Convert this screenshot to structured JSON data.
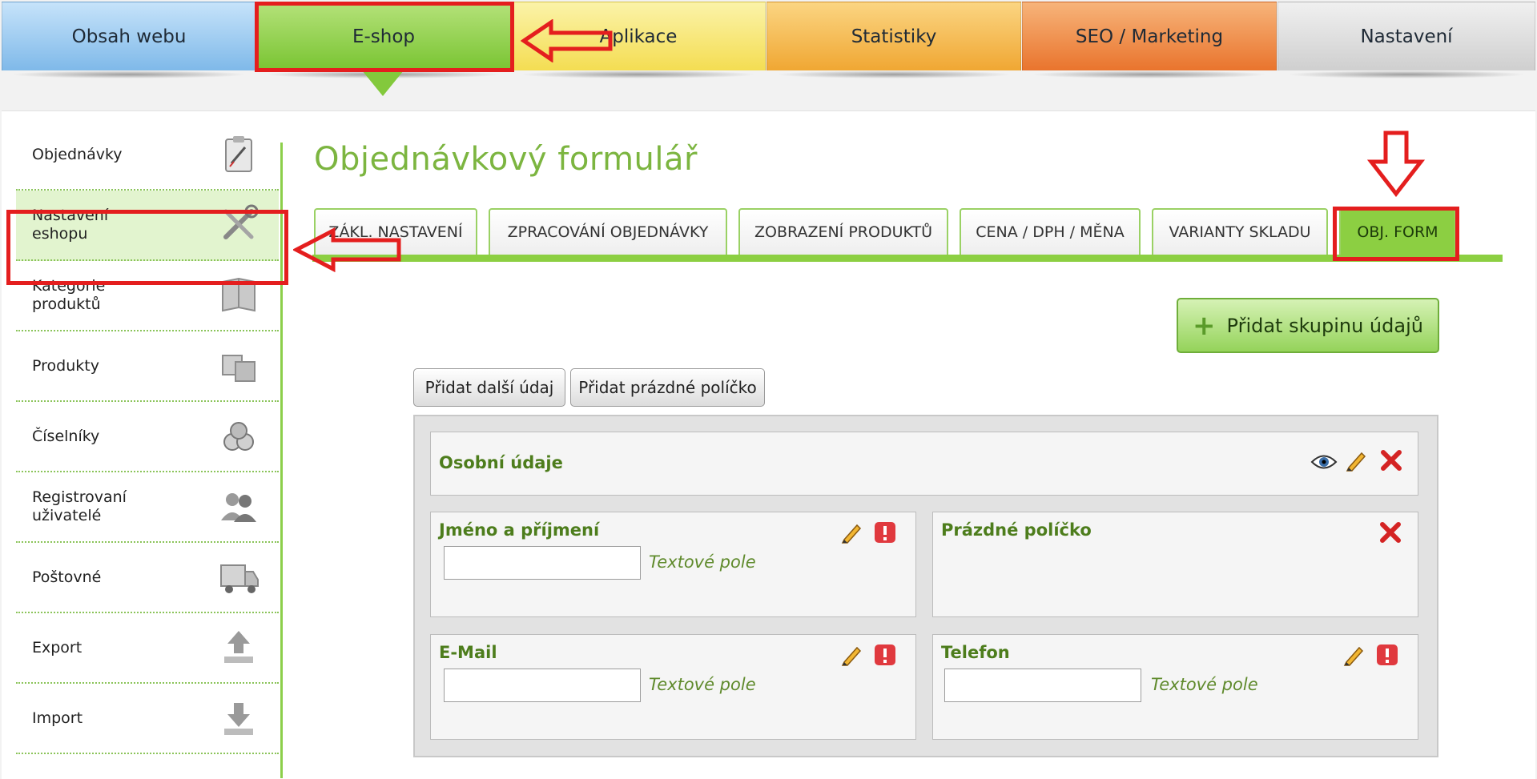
{
  "top_nav": {
    "tabs": [
      {
        "label": "Obsah webu"
      },
      {
        "label": "E-shop"
      },
      {
        "label": "Aplikace"
      },
      {
        "label": "Statistiky"
      },
      {
        "label": "SEO / Marketing"
      },
      {
        "label": "Nastavení"
      }
    ],
    "active_index": 1
  },
  "sidebar": {
    "items": [
      {
        "label": "Objednávky",
        "icon": "clipboard-icon"
      },
      {
        "label": "Nastavení\neshopu",
        "icon": "tools-icon",
        "active": true
      },
      {
        "label": "Kategorie\nproduktů",
        "icon": "book-icon"
      },
      {
        "label": "Produkty",
        "icon": "boxes-icon"
      },
      {
        "label": "Číselníky",
        "icon": "numbers-icon"
      },
      {
        "label": "Registrovaní\nuživatelé",
        "icon": "users-icon"
      },
      {
        "label": "Poštovné",
        "icon": "truck-icon"
      },
      {
        "label": "Export",
        "icon": "upload-icon"
      },
      {
        "label": "Import",
        "icon": "download-icon"
      }
    ]
  },
  "main": {
    "title": "Objednávkový formulář",
    "tabs": [
      {
        "label": "ZÁKL. NASTAVENÍ"
      },
      {
        "label": "ZPRACOVÁNÍ OBJEDNÁVKY"
      },
      {
        "label": "ZOBRAZENÍ PRODUKTŮ"
      },
      {
        "label": "CENA / DPH / MĚNA"
      },
      {
        "label": "VARIANTY SKLADU"
      },
      {
        "label": "OBJ. FORM"
      }
    ],
    "active_tab": 5,
    "add_group_label": "Přidat skupinu údajů",
    "add_field_label": "Přidat další údaj",
    "add_empty_label": "Přidat prázdné políčko"
  },
  "form": {
    "group_title": "Osobní údaje",
    "fields": [
      {
        "label": "Jméno a příjmení",
        "type": "Textové pole"
      },
      {
        "label": "Prázdné políčko",
        "type": ""
      },
      {
        "label": "E-Mail",
        "type": "Textové pole"
      },
      {
        "label": "Telefon",
        "type": "Textové pole"
      }
    ]
  },
  "colors": {
    "accent_green": "#8ccf42",
    "label_green": "#4d7d1c",
    "annotation_red": "#e41e1e"
  }
}
